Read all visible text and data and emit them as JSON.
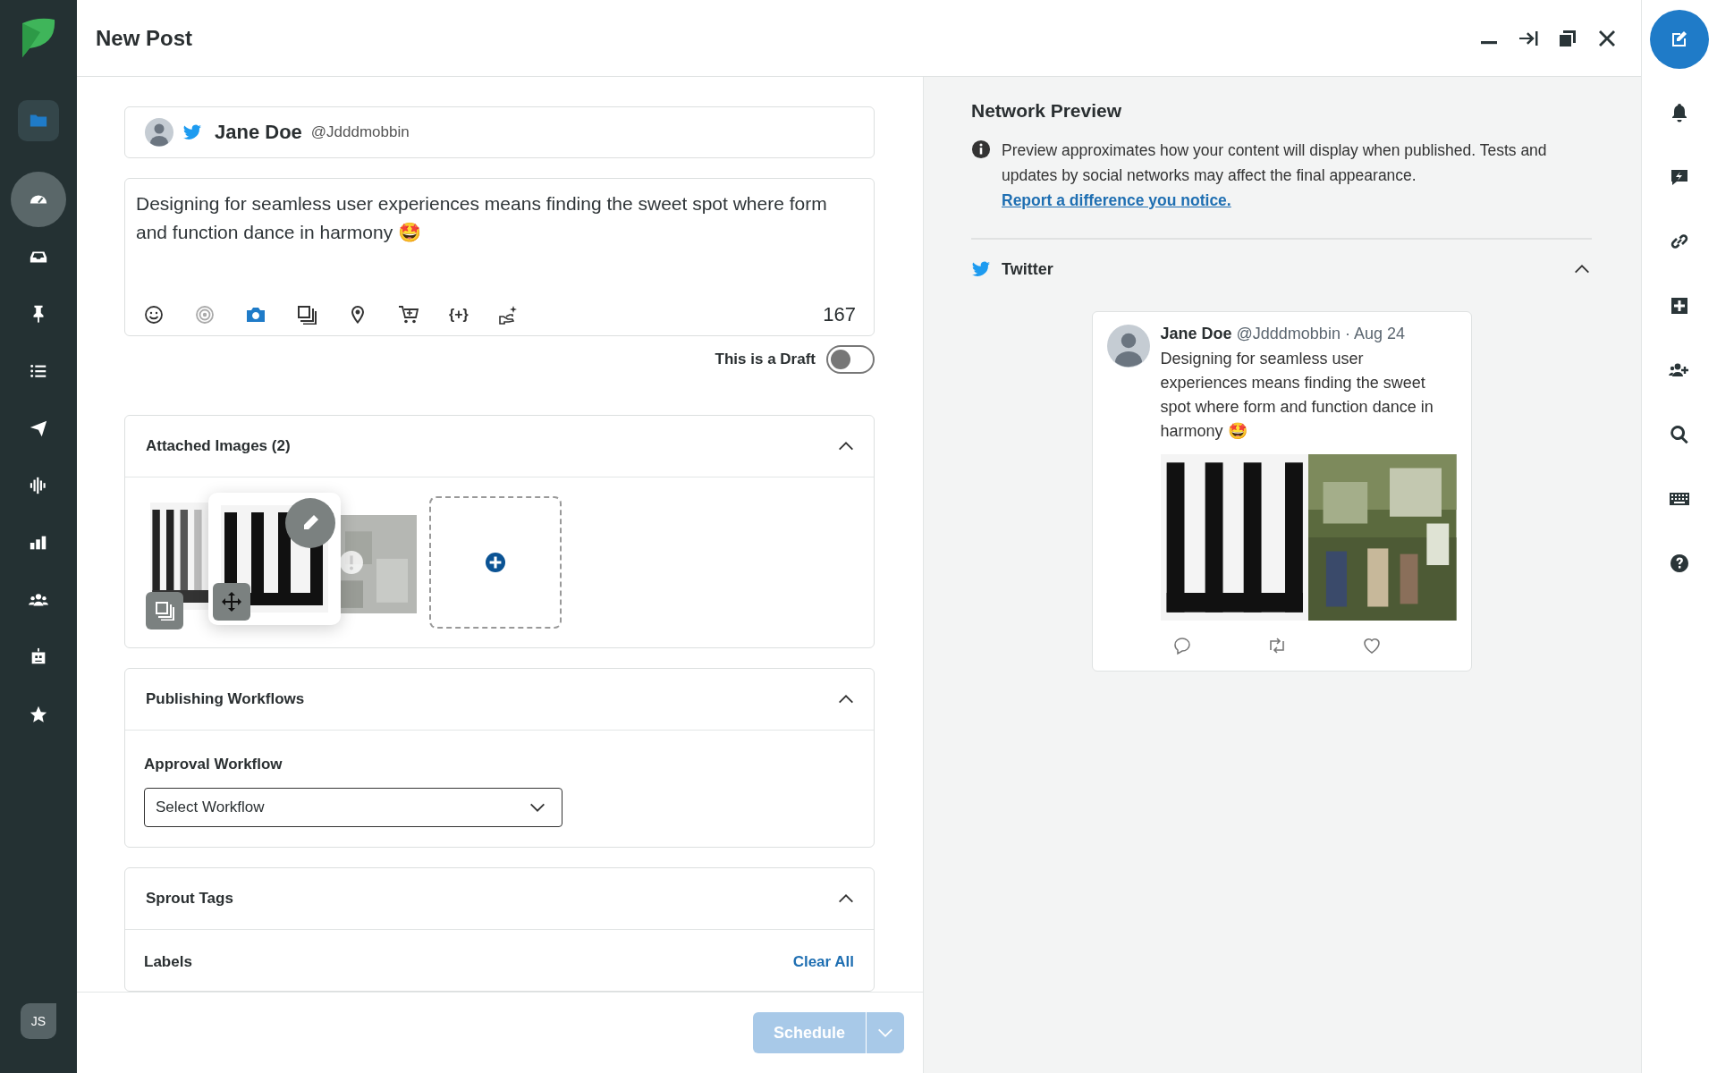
{
  "sidebar": {
    "items": [
      {
        "kind": "folder",
        "selected": true,
        "hovered": false
      },
      {
        "kind": "gauge",
        "selected": false,
        "hovered": true
      },
      {
        "kind": "inbox",
        "selected": false,
        "hovered": false
      },
      {
        "kind": "pin",
        "selected": false,
        "hovered": false
      },
      {
        "kind": "list",
        "selected": false,
        "hovered": false
      },
      {
        "kind": "send",
        "selected": false,
        "hovered": false
      },
      {
        "kind": "wave",
        "selected": false,
        "hovered": false
      },
      {
        "kind": "bars",
        "selected": false,
        "hovered": false
      },
      {
        "kind": "people",
        "selected": false,
        "hovered": false
      },
      {
        "kind": "robot",
        "selected": false,
        "hovered": false
      },
      {
        "kind": "star",
        "selected": false,
        "hovered": false
      }
    ],
    "user_initials": "JS"
  },
  "window": {
    "title": "New Post",
    "controls": [
      {
        "kind": "minimize"
      },
      {
        "kind": "dock"
      },
      {
        "kind": "popout"
      },
      {
        "kind": "close"
      }
    ]
  },
  "account": {
    "name": "Jane Doe",
    "handle": "@Jdddmobbin"
  },
  "composer": {
    "text": "Designing for seamless user experiences means finding the sweet spot where form and function dance in harmony 🤩",
    "tools": [
      {
        "kind": "emoji",
        "disabled": false,
        "active": false
      },
      {
        "kind": "target",
        "disabled": true,
        "active": false
      },
      {
        "kind": "camera",
        "disabled": false,
        "active": true
      },
      {
        "kind": "gallery",
        "disabled": false,
        "active": false
      },
      {
        "kind": "location",
        "disabled": false,
        "active": false
      },
      {
        "kind": "cart",
        "disabled": false,
        "active": false
      },
      {
        "kind": "text",
        "label": "{+}",
        "disabled": false,
        "active": false
      },
      {
        "kind": "hand",
        "disabled": false,
        "active": false
      }
    ],
    "count": "167"
  },
  "draft": {
    "label": "This is a Draft",
    "on": false
  },
  "sections": [
    {
      "kind": "images",
      "title": "Attached Images (2)",
      "expanded": true
    },
    {
      "kind": "workflow",
      "title": "Publishing Workflows",
      "expanded": true,
      "field_label": "Approval Workflow",
      "select": "Select Workflow"
    },
    {
      "kind": "tags",
      "title": "Sprout Tags",
      "expanded": true,
      "field_label": "Labels",
      "action": "Clear All"
    }
  ],
  "footer": {
    "button": "Schedule",
    "disabled": true
  },
  "preview": {
    "title": "Network Preview",
    "note": "Preview approximates how your content will display when published. Tests and updates by social networks may affect the final appearance.",
    "link": "Report a difference you notice.",
    "network": {
      "name": "Twitter",
      "expanded": true
    },
    "tweet": {
      "name": "Jane Doe",
      "handle": "@Jdddmobbin",
      "date": "· Aug 24",
      "text": "Designing for seamless user experiences means finding the sweet spot where form and function dance in harmony 🤩"
    }
  },
  "right_bar": [
    {
      "kind": "compose",
      "selected": true
    },
    {
      "kind": "bell",
      "selected": false
    },
    {
      "kind": "message",
      "selected": false
    },
    {
      "kind": "link",
      "selected": false
    },
    {
      "kind": "plus",
      "selected": false
    },
    {
      "kind": "useradd",
      "selected": false
    },
    {
      "kind": "search",
      "selected": false
    },
    {
      "kind": "keyboard",
      "selected": false
    },
    {
      "kind": "help",
      "selected": false
    }
  ]
}
